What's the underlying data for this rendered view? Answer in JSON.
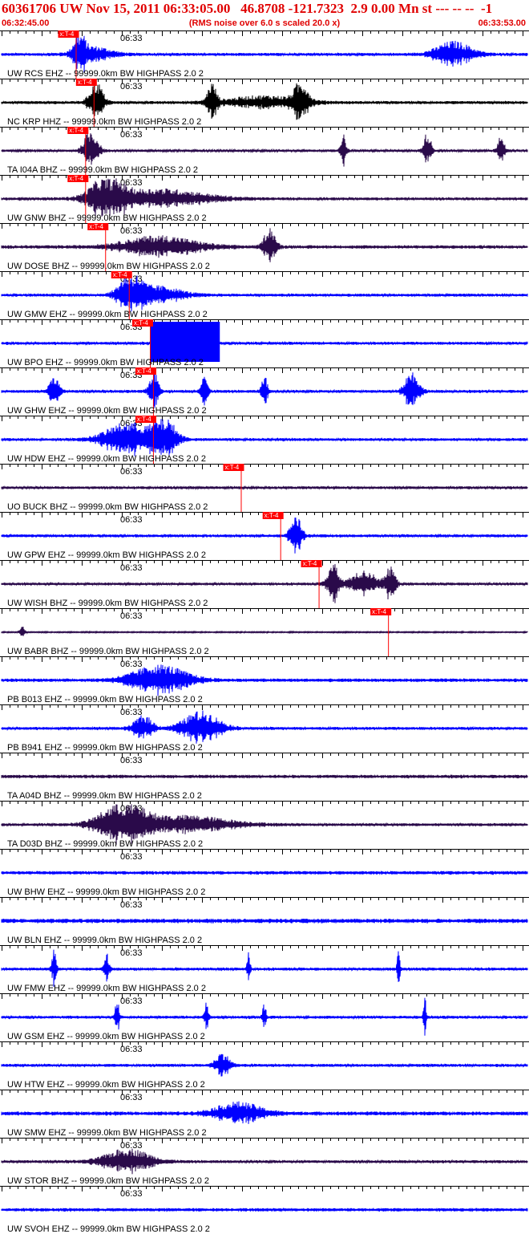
{
  "header": {
    "title": "60361706 UW Nov 15, 2011 06:33:05.00   46.8708 -121.7323  2.9 0.00 Mn st --- -- --  -1",
    "start_time": "06:32:45.00",
    "note": "(RMS noise over 6.0 s scaled 20.0 x)",
    "end_time": "06:33:53.00"
  },
  "colors": {
    "title": "#e00000",
    "trace_blue": "#0000ff",
    "trace_black": "#000000",
    "trace_purple": "#2a0a4a",
    "pick": "#ff0000",
    "axis": "#000000"
  },
  "chart_data": {
    "type": "seismogram",
    "x_range": [
      "06:32:45.00",
      "06:33:53.00"
    ],
    "minute_mark_label": "06:33",
    "pick_label": "x:T-4",
    "traces": [
      {
        "label": "UW RCS EHZ -- 99999.0km BW  HIGHPASS  2.0  2",
        "color": "blue",
        "pick_frac": 0.141,
        "noise": 0.3,
        "bursts": [
          {
            "c": 0.148,
            "w": 0.012,
            "a": 1.0
          },
          {
            "c": 0.175,
            "w": 0.04,
            "a": 0.35
          },
          {
            "c": 0.86,
            "w": 0.04,
            "a": 0.6
          }
        ]
      },
      {
        "label": "NC KRP HHZ -- 99999.0km BW  HIGHPASS  2.0  2",
        "color": "black",
        "pick_frac": 0.175,
        "noise": 0.3,
        "bursts": [
          {
            "c": 0.18,
            "w": 0.015,
            "a": 1.0
          },
          {
            "c": 0.4,
            "w": 0.01,
            "a": 0.9
          },
          {
            "c": 0.57,
            "w": 0.015,
            "a": 1.0
          },
          {
            "c": 0.5,
            "w": 0.08,
            "a": 0.3
          }
        ]
      },
      {
        "label": "TA I04A BHZ -- 99999.0km BW  HIGHPASS  2.0  2",
        "color": "purple",
        "pick_frac": 0.159,
        "noise": 0.25,
        "bursts": [
          {
            "c": 0.17,
            "w": 0.015,
            "a": 1.0
          },
          {
            "c": 0.65,
            "w": 0.006,
            "a": 0.8
          },
          {
            "c": 0.81,
            "w": 0.008,
            "a": 0.9
          },
          {
            "c": 0.95,
            "w": 0.007,
            "a": 0.9
          }
        ]
      },
      {
        "label": "UW GNW BHZ -- 99999.0km BW  HIGHPASS  2.0  2",
        "color": "purple",
        "pick_frac": 0.159,
        "noise": 0.3,
        "bursts": [
          {
            "c": 0.2,
            "w": 0.035,
            "a": 1.0
          },
          {
            "c": 0.3,
            "w": 0.1,
            "a": 0.45
          }
        ]
      },
      {
        "label": "UW DOSE BHZ -- 99999.0km BW  HIGHPASS  2.0  2",
        "color": "purple",
        "pick_frac": 0.197,
        "noise": 0.35,
        "bursts": [
          {
            "c": 0.3,
            "w": 0.08,
            "a": 0.5
          },
          {
            "c": 0.51,
            "w": 0.012,
            "a": 1.0
          }
        ]
      },
      {
        "label": "UW GMW EHZ -- 99999.0km BW  HIGHPASS  2.0  2",
        "color": "blue",
        "pick_frac": 0.242,
        "noise": 0.3,
        "bursts": [
          {
            "c": 0.245,
            "w": 0.025,
            "a": 1.0
          },
          {
            "c": 0.3,
            "w": 0.05,
            "a": 0.4
          }
        ]
      },
      {
        "label": "UW BPO EHZ -- 99999.0km BW  HIGHPASS  2.0  2",
        "color": "blue",
        "pick_frac": 0.282,
        "noise": 0.3,
        "saturated": [
          0.282,
          0.415
        ],
        "bursts": []
      },
      {
        "label": "UW GHW EHZ -- 99999.0km BW  HIGHPASS  2.0  2",
        "color": "blue",
        "pick_frac": 0.288,
        "noise": 0.3,
        "bursts": [
          {
            "c": 0.1,
            "w": 0.01,
            "a": 0.8
          },
          {
            "c": 0.29,
            "w": 0.01,
            "a": 1.0
          },
          {
            "c": 0.385,
            "w": 0.007,
            "a": 0.9
          },
          {
            "c": 0.5,
            "w": 0.006,
            "a": 0.8
          },
          {
            "c": 0.78,
            "w": 0.015,
            "a": 1.0
          }
        ]
      },
      {
        "label": "UW HDW EHZ -- 99999.0km BW  HIGHPASS  2.0  2",
        "color": "blue",
        "pick_frac": 0.288,
        "noise": 0.3,
        "bursts": [
          {
            "c": 0.24,
            "w": 0.05,
            "a": 0.8
          },
          {
            "c": 0.31,
            "w": 0.025,
            "a": 1.0
          }
        ]
      },
      {
        "label": "UO BUCK BHZ -- 99999.0km BW  HIGHPASS  2.0  2",
        "color": "purple",
        "pick_frac": 0.455,
        "noise": 0.28,
        "bursts": []
      },
      {
        "label": "UW GPW EHZ -- 99999.0km BW  HIGHPASS  2.0  2",
        "color": "blue",
        "pick_frac": 0.53,
        "noise": 0.3,
        "bursts": [
          {
            "c": 0.56,
            "w": 0.012,
            "a": 1.0
          }
        ]
      },
      {
        "label": "UW WISH BHZ -- 99999.0km BW  HIGHPASS  2.0  2",
        "color": "purple",
        "pick_frac": 0.603,
        "noise": 0.28,
        "bursts": [
          {
            "c": 0.63,
            "w": 0.012,
            "a": 1.0
          },
          {
            "c": 0.69,
            "w": 0.03,
            "a": 0.6
          },
          {
            "c": 0.74,
            "w": 0.01,
            "a": 0.8
          }
        ]
      },
      {
        "label": "UW BABR BHZ -- 99999.0km BW  HIGHPASS  2.0  2",
        "color": "purple",
        "pick_frac": 0.735,
        "noise": 0.12,
        "bursts": [
          {
            "c": 0.04,
            "w": 0.005,
            "a": 0.3
          }
        ]
      },
      {
        "label": "PB B013 EHZ -- 99999.0km BW  HIGHPASS  2.0  2",
        "color": "blue",
        "pick_frac": null,
        "noise": 0.35,
        "bursts": [
          {
            "c": 0.3,
            "w": 0.06,
            "a": 0.7
          }
        ]
      },
      {
        "label": "PB B941 EHZ -- 99999.0km BW  HIGHPASS  2.0  2",
        "color": "blue",
        "pick_frac": null,
        "noise": 0.3,
        "bursts": [
          {
            "c": 0.27,
            "w": 0.02,
            "a": 0.6
          },
          {
            "c": 0.38,
            "w": 0.04,
            "a": 0.8
          }
        ]
      },
      {
        "label": "TA A04D BHZ -- 99999.0km BW  HIGHPASS  2.0  2",
        "color": "purple",
        "pick_frac": null,
        "noise": 0.35,
        "bursts": []
      },
      {
        "label": "TA D03D BHZ -- 99999.0km BW  HIGHPASS  2.0  2",
        "color": "purple",
        "pick_frac": null,
        "noise": 0.3,
        "bursts": [
          {
            "c": 0.23,
            "w": 0.05,
            "a": 1.0
          },
          {
            "c": 0.35,
            "w": 0.1,
            "a": 0.4
          }
        ]
      },
      {
        "label": "UW BHW EHZ -- 99999.0km BW  HIGHPASS  2.0  2",
        "color": "blue",
        "pick_frac": null,
        "noise": 0.35,
        "bursts": []
      },
      {
        "label": "UW BLN EHZ -- 99999.0km BW  HIGHPASS  2.0  2",
        "color": "blue",
        "pick_frac": null,
        "noise": 0.45,
        "bursts": []
      },
      {
        "label": "UW FMW EHZ -- 99999.0km BW  HIGHPASS  2.0  2",
        "color": "blue",
        "pick_frac": null,
        "noise": 0.3,
        "bursts": [
          {
            "c": 0.1,
            "w": 0.005,
            "a": 0.9
          },
          {
            "c": 0.2,
            "w": 0.005,
            "a": 0.8
          },
          {
            "c": 0.47,
            "w": 0.003,
            "a": 1.0
          },
          {
            "c": 0.755,
            "w": 0.003,
            "a": 1.0
          }
        ]
      },
      {
        "label": "UW GSM EHZ -- 99999.0km BW  HIGHPASS  2.0  2",
        "color": "blue",
        "pick_frac": null,
        "noise": 0.3,
        "bursts": [
          {
            "c": 0.22,
            "w": 0.004,
            "a": 1.0
          },
          {
            "c": 0.39,
            "w": 0.004,
            "a": 0.8
          },
          {
            "c": 0.5,
            "w": 0.004,
            "a": 0.7
          },
          {
            "c": 0.805,
            "w": 0.003,
            "a": 1.0
          }
        ]
      },
      {
        "label": "UW HTW EHZ -- 99999.0km BW  HIGHPASS  2.0  2",
        "color": "blue",
        "pick_frac": null,
        "noise": 0.3,
        "bursts": [
          {
            "c": 0.42,
            "w": 0.015,
            "a": 0.6
          }
        ]
      },
      {
        "label": "UW SMW EHZ -- 99999.0km BW  HIGHPASS  2.0  2",
        "color": "blue",
        "pick_frac": null,
        "noise": 0.4,
        "bursts": [
          {
            "c": 0.45,
            "w": 0.05,
            "a": 0.5
          }
        ]
      },
      {
        "label": "UW STOR BHZ -- 99999.0km BW  HIGHPASS  2.0  2",
        "color": "purple",
        "pick_frac": null,
        "noise": 0.3,
        "bursts": [
          {
            "c": 0.24,
            "w": 0.05,
            "a": 0.6
          }
        ]
      },
      {
        "label": "UW SVOH EHZ -- 99999.0km BW  HIGHPASS  2.0  2",
        "color": "blue",
        "pick_frac": null,
        "noise": 0.35,
        "bursts": []
      }
    ]
  }
}
